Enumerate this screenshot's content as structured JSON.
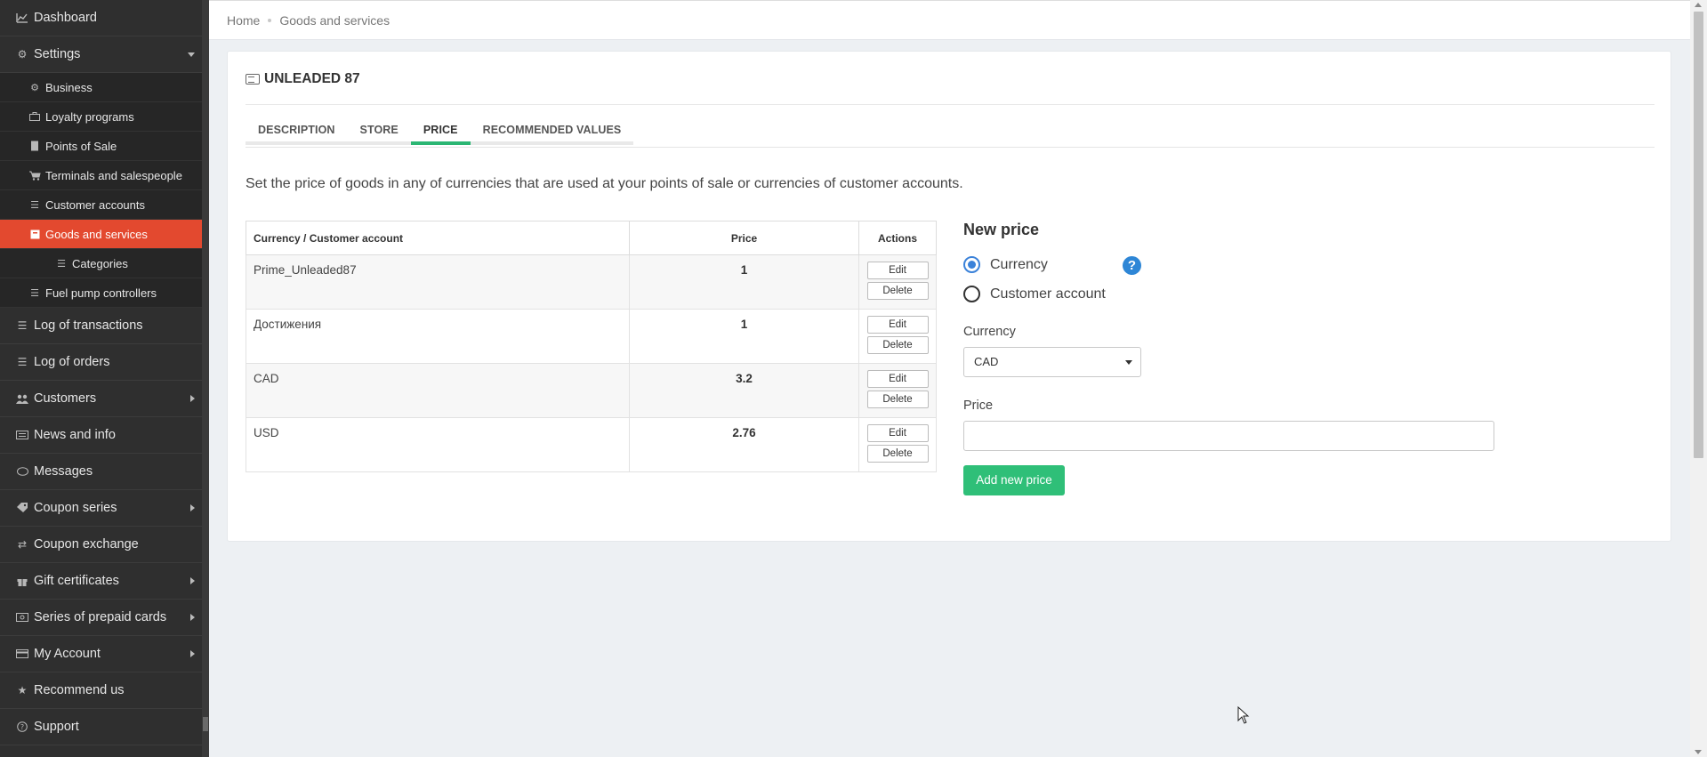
{
  "sidebar": {
    "items": [
      {
        "label": "Dashboard",
        "icon": "chart-line-icon"
      },
      {
        "label": "Settings",
        "icon": "gear-icon"
      },
      {
        "label": "Business",
        "icon": "gear-icon"
      },
      {
        "label": "Loyalty programs",
        "icon": "briefcase-icon"
      },
      {
        "label": "Points of Sale",
        "icon": "building-icon"
      },
      {
        "label": "Terminals and salespeople",
        "icon": "cart-icon"
      },
      {
        "label": "Customer accounts",
        "icon": "list-icon"
      },
      {
        "label": "Goods and services",
        "icon": "box-icon"
      },
      {
        "label": "Categories",
        "icon": "list-icon"
      },
      {
        "label": "Fuel pump controllers",
        "icon": "list-icon"
      },
      {
        "label": "Log of transactions",
        "icon": "list-icon"
      },
      {
        "label": "Log of orders",
        "icon": "list-icon"
      },
      {
        "label": "Customers",
        "icon": "users-icon"
      },
      {
        "label": "News and info",
        "icon": "newspaper-icon"
      },
      {
        "label": "Messages",
        "icon": "comment-icon"
      },
      {
        "label": "Coupon series",
        "icon": "tags-icon"
      },
      {
        "label": "Coupon exchange",
        "icon": "exchange-icon"
      },
      {
        "label": "Gift certificates",
        "icon": "gift-icon"
      },
      {
        "label": "Series of prepaid cards",
        "icon": "money-icon"
      },
      {
        "label": "My Account",
        "icon": "credit-card-icon"
      },
      {
        "label": "Recommend us",
        "icon": "star-icon"
      },
      {
        "label": "Support",
        "icon": "question-circle-icon"
      }
    ]
  },
  "breadcrumb": {
    "home": "Home",
    "current": "Goods and services"
  },
  "page": {
    "title": "UNLEADED 87"
  },
  "tabs": [
    {
      "label": "DESCRIPTION"
    },
    {
      "label": "STORE"
    },
    {
      "label": "PRICE"
    },
    {
      "label": "RECOMMENDED VALUES"
    }
  ],
  "active_tab": "PRICE",
  "intro": "Set the price of goods in any of currencies that are used at your points of sale or currencies of customer accounts.",
  "table": {
    "headers": [
      "Currency / Customer account",
      "Price",
      "Actions"
    ],
    "rows": [
      {
        "account": "Prime_Unleaded87",
        "price": "1"
      },
      {
        "account": "Достижения",
        "price": "1"
      },
      {
        "account": "CAD",
        "price": "3.2"
      },
      {
        "account": "USD",
        "price": "2.76"
      }
    ],
    "edit_label": "Edit",
    "delete_label": "Delete"
  },
  "new_price": {
    "title": "New price",
    "radio_currency": "Currency",
    "radio_account": "Customer account",
    "help": "?",
    "currency_label": "Currency",
    "currency_value": "CAD",
    "price_label": "Price",
    "price_value": "",
    "add_button": "Add new price"
  },
  "colors": {
    "active_menu": "#e3492f",
    "accent_green": "#2fbf78",
    "radio_blue": "#3b82d9"
  }
}
